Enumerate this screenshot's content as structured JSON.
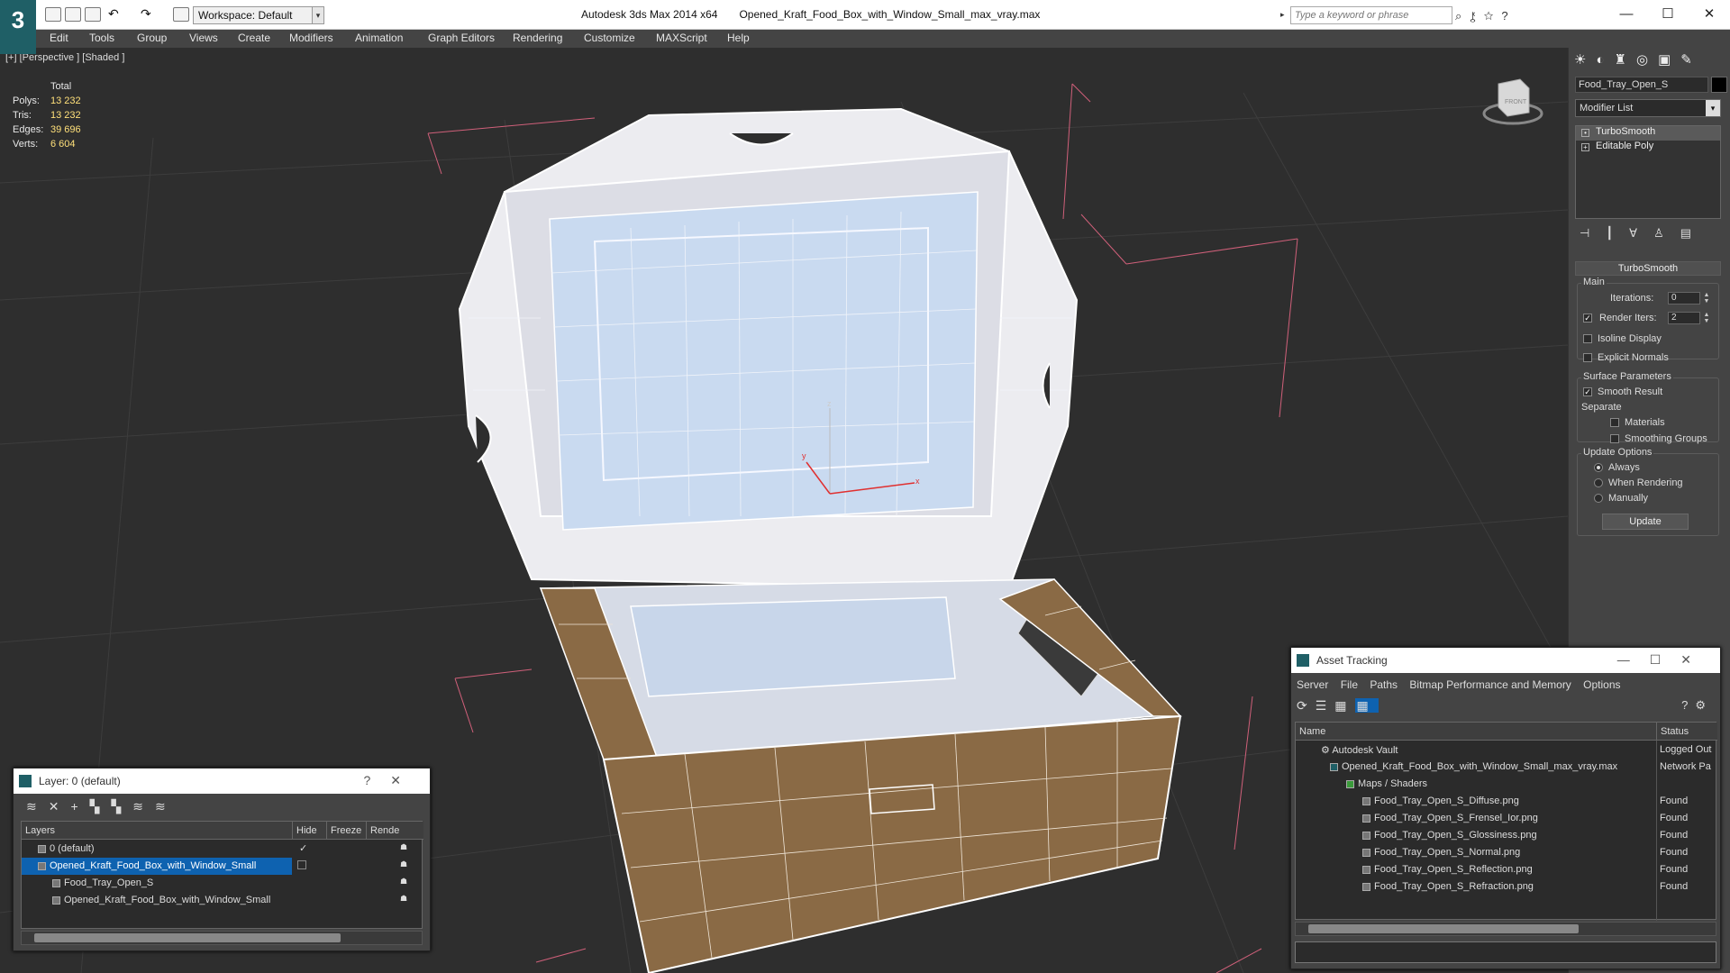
{
  "window": {
    "app_title": "Autodesk 3ds Max  2014 x64",
    "file_title": "Opened_Kraft_Food_Box_with_Window_Small_max_vray.max",
    "workspace": "Workspace: Default",
    "search_placeholder": "Type a keyword or phrase",
    "logo": "3"
  },
  "menu": [
    "Edit",
    "Tools",
    "Group",
    "Views",
    "Create",
    "Modifiers",
    "Animation",
    "Graph Editors",
    "Rendering",
    "Customize",
    "MAXScript",
    "Help"
  ],
  "viewport": {
    "label": "[+] [Perspective ] [Shaded ]",
    "stats_header": "Total",
    "stats": [
      {
        "label": "Polys:",
        "value": "13 232"
      },
      {
        "label": "Tris:",
        "value": "13 232"
      },
      {
        "label": "Edges:",
        "value": "39 696"
      },
      {
        "label": "Verts:",
        "value": "6 604"
      }
    ],
    "axis": {
      "x": "x",
      "y": "y",
      "z": "z"
    },
    "viewcube_label": "FRONT"
  },
  "command_panel": {
    "object_name": "Food_Tray_Open_S",
    "modifier_list": "Modifier List",
    "stack": [
      "TurboSmooth",
      "Editable Poly"
    ],
    "rollout_title": "TurboSmooth",
    "main_group": "Main",
    "iterations_label": "Iterations:",
    "iterations_value": "0",
    "render_iters_label": "Render Iters:",
    "render_iters_value": "2",
    "isoline": "Isoline Display",
    "explicit_normals": "Explicit Normals",
    "surface_group": "Surface Parameters",
    "smooth_result": "Smooth Result",
    "separate": "Separate",
    "materials": "Materials",
    "smoothing_groups": "Smoothing Groups",
    "update_group": "Update Options",
    "always": "Always",
    "when_rendering": "When Rendering",
    "manually": "Manually",
    "update_button": "Update"
  },
  "layer_panel": {
    "title": "Layer: 0 (default)",
    "help": "?",
    "columns": [
      "Layers",
      "Hide",
      "Freeze",
      "Rende"
    ],
    "rows": [
      {
        "name": "0 (default)",
        "indent": 1,
        "selected": false
      },
      {
        "name": "Opened_Kraft_Food_Box_with_Window_Small",
        "indent": 1,
        "selected": true
      },
      {
        "name": "Food_Tray_Open_S",
        "indent": 2,
        "selected": false
      },
      {
        "name": "Opened_Kraft_Food_Box_with_Window_Small",
        "indent": 2,
        "selected": false
      }
    ]
  },
  "asset_panel": {
    "title": "Asset Tracking",
    "menu": [
      "Server",
      "File",
      "Paths",
      "Bitmap Performance and Memory",
      "Options"
    ],
    "columns": [
      "Name",
      "Status"
    ],
    "rows": [
      {
        "name": "Autodesk Vault",
        "status": "Logged Out",
        "indent": 1
      },
      {
        "name": "Opened_Kraft_Food_Box_with_Window_Small_max_vray.max",
        "status": "Network Pa",
        "indent": 2
      },
      {
        "name": "Maps / Shaders",
        "status": "",
        "indent": 3
      },
      {
        "name": "Food_Tray_Open_S_Diffuse.png",
        "status": "Found",
        "indent": 4
      },
      {
        "name": "Food_Tray_Open_S_Frensel_Ior.png",
        "status": "Found",
        "indent": 4
      },
      {
        "name": "Food_Tray_Open_S_Glossiness.png",
        "status": "Found",
        "indent": 4
      },
      {
        "name": "Food_Tray_Open_S_Normal.png",
        "status": "Found",
        "indent": 4
      },
      {
        "name": "Food_Tray_Open_S_Reflection.png",
        "status": "Found",
        "indent": 4
      },
      {
        "name": "Food_Tray_Open_S_Refraction.png",
        "status": "Found",
        "indent": 4
      }
    ]
  },
  "colors": {
    "selection": "#0e62b0",
    "kraft": "#8a6a45",
    "bounding_box": "#d0607a",
    "stats_value": "#ffe07a"
  }
}
